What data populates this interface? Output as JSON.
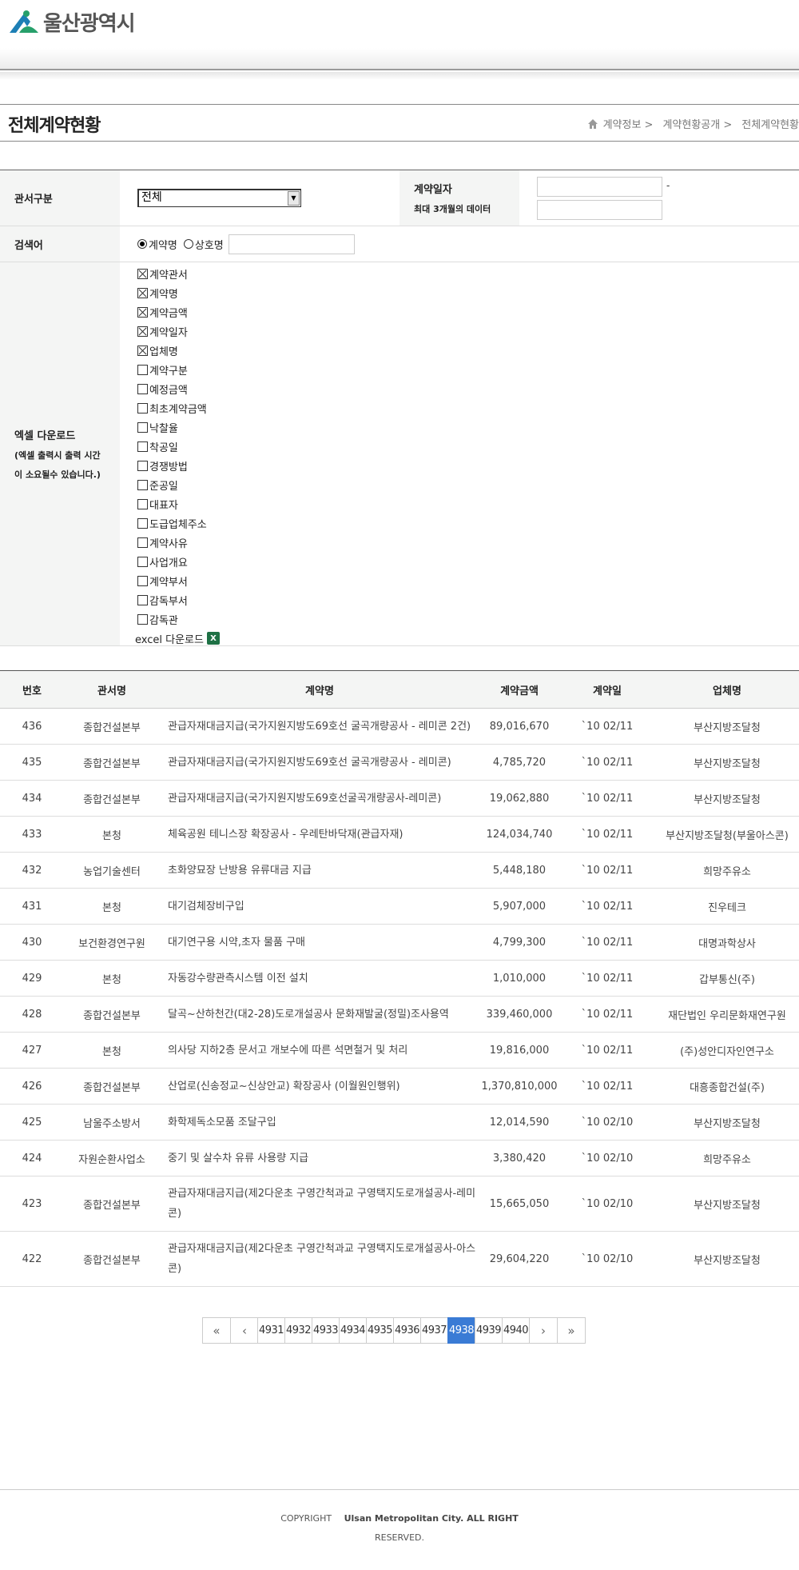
{
  "header": {
    "logo_text": "울산광역시"
  },
  "page": {
    "title": "전체계약현황",
    "breadcrumb": [
      "계약정보 >",
      "계약현황공개 >",
      "전체계약현황"
    ]
  },
  "search": {
    "office_label": "관서구분",
    "office_value": "전체",
    "date_label": "계약일자",
    "date_note": "최대 3개월의 데이터",
    "date_sep": "-",
    "keyword_label": "검색어",
    "radio_contract": "계약명",
    "radio_company": "상호명",
    "excel_label": "엑셀 다운로드",
    "excel_note_1": "(엑셀 출력시 출력 시간",
    "excel_note_2": "이 소요될수 있습니다.)",
    "checkboxes": [
      {
        "label": "계약관서",
        "checked": true
      },
      {
        "label": "계약명",
        "checked": true
      },
      {
        "label": "계약금액",
        "checked": true
      },
      {
        "label": "계약일자",
        "checked": true
      },
      {
        "label": "업체명",
        "checked": true
      },
      {
        "label": "계약구분",
        "checked": false
      },
      {
        "label": "예정금액",
        "checked": false
      },
      {
        "label": "최초계약금액",
        "checked": false
      },
      {
        "label": "낙찰율",
        "checked": false
      },
      {
        "label": "착공일",
        "checked": false
      },
      {
        "label": "경쟁방법",
        "checked": false
      },
      {
        "label": "준공일",
        "checked": false
      },
      {
        "label": "대표자",
        "checked": false
      },
      {
        "label": "도급업체주소",
        "checked": false
      },
      {
        "label": "계약사유",
        "checked": false
      },
      {
        "label": "사업개요",
        "checked": false
      },
      {
        "label": "계약부서",
        "checked": false
      },
      {
        "label": "감독부서",
        "checked": false
      },
      {
        "label": "감독관",
        "checked": false
      }
    ],
    "excel_download": "excel 다운로드"
  },
  "table": {
    "headers": [
      "번호",
      "관서명",
      "계약명",
      "계약금액",
      "계약일",
      "업체명"
    ],
    "rows": [
      [
        "436",
        "종합건설본부",
        "관급자재대금지급(국가지원지방도69호선 굴곡개량공사 - 레미콘 2건)",
        "89,016,670",
        "`10 02/11",
        "부산지방조달청"
      ],
      [
        "435",
        "종합건설본부",
        "관급자재대금지급(국가지원지방도69호선 굴곡개량공사 - 레미콘)",
        "4,785,720",
        "`10 02/11",
        "부산지방조달청"
      ],
      [
        "434",
        "종합건설본부",
        "관급자재대금지급(국가지원지방도69호선굴곡개량공사-레미콘)",
        "19,062,880",
        "`10 02/11",
        "부산지방조달청"
      ],
      [
        "433",
        "본청",
        "체육공원 테니스장 확장공사 - 우레탄바닥재(관급자재)",
        "124,034,740",
        "`10 02/11",
        "부산지방조달청(부울아스콘)"
      ],
      [
        "432",
        "농업기술센터",
        "초화양묘장 난방용 유류대금 지급",
        "5,448,180",
        "`10 02/11",
        "희망주유소"
      ],
      [
        "431",
        "본청",
        "대기검체장비구입",
        "5,907,000",
        "`10 02/11",
        "진우테크"
      ],
      [
        "430",
        "보건환경연구원",
        "대기연구용 시약,초자 물품 구매",
        "4,799,300",
        "`10 02/11",
        "대명과학상사"
      ],
      [
        "429",
        "본청",
        "자동강수량관측시스템 이전 설치",
        "1,010,000",
        "`10 02/11",
        "갑부통신(주)"
      ],
      [
        "428",
        "종합건설본부",
        "달곡~산하천간(대2-28)도로개설공사 문화재발굴(정밀)조사용역",
        "339,460,000",
        "`10 02/11",
        "재단법인 우리문화재연구원"
      ],
      [
        "427",
        "본청",
        "의사당 지하2층 문서고 개보수에 따른 석면철거 및 처리",
        "19,816,000",
        "`10 02/11",
        "(주)성안디자인연구소"
      ],
      [
        "426",
        "종합건설본부",
        "산업로(신송정교~신상안교) 확장공사 (이월원인행위)",
        "1,370,810,000",
        "`10 02/11",
        "대흥종합건설(주)"
      ],
      [
        "425",
        "남울주소방서",
        "화학제독소모품 조달구입",
        "12,014,590",
        "`10 02/10",
        "부산지방조달청"
      ],
      [
        "424",
        "자원순환사업소",
        "중기 및 살수차 유류 사용량 지급",
        "3,380,420",
        "`10 02/10",
        "희망주유소"
      ],
      [
        "423",
        "종합건설본부",
        "관급자재대금지급(제2다운초 구영간척과교 구영택지도로개설공사-레미콘)",
        "15,665,050",
        "`10 02/10",
        "부산지방조달청"
      ],
      [
        "422",
        "종합건설본부",
        "관급자재대금지급(제2다운초 구영간척과교 구영택지도로개설공사-아스콘)",
        "29,604,220",
        "`10 02/10",
        "부산지방조달청"
      ]
    ]
  },
  "pagination": {
    "first": "«",
    "prev": "‹",
    "pages": [
      "4931",
      "4932",
      "4933",
      "4934",
      "4935",
      "4936",
      "4937",
      "4938",
      "4939",
      "4940"
    ],
    "active": "4938",
    "next": "›",
    "last": "»"
  },
  "footer": {
    "copyright": "COPYRIGHT",
    "owner": "Ulsan Metropolitan City. ALL RIGHT",
    "reserved": "RESERVED."
  }
}
